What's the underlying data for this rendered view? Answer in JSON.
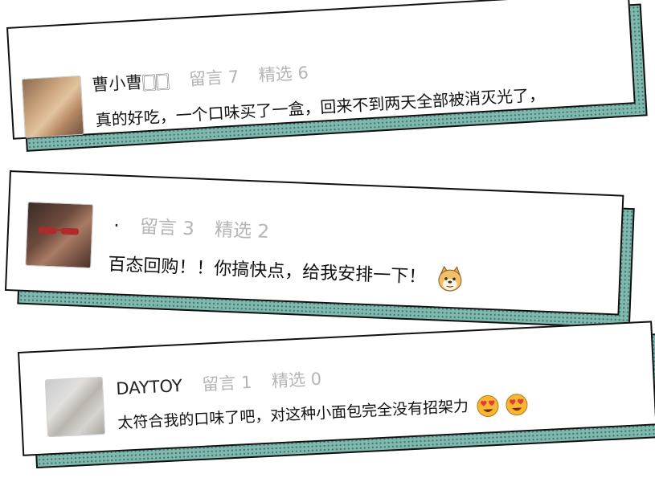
{
  "labels": {
    "comments": "留言",
    "featured": "精选"
  },
  "comments": [
    {
      "username": "曹小曹🀆🀆",
      "comment_count": 7,
      "featured_count": 6,
      "text": "真的好吃，一个口味买了一盒，回来不到两天全部被消灭光了，",
      "avatar_icon": "avatar-photo-two-people",
      "emojis": []
    },
    {
      "username": "·",
      "comment_count": 3,
      "featured_count": 2,
      "text": "百态回购！！你搞快点，给我安排一下！",
      "avatar_icon": "avatar-photo-girl-sunglasses",
      "emojis": [
        "doge-emoji"
      ]
    },
    {
      "username": "DAYTOY",
      "comment_count": 1,
      "featured_count": 0,
      "text": "太符合我的口味了吧，对这种小面包完全没有招架力",
      "avatar_icon": "avatar-photo-blurry",
      "emojis": [
        "heart-eyes-emoji",
        "heart-eyes-emoji"
      ]
    }
  ],
  "colors": {
    "shadow_teal": "#7fb8ad",
    "stat_gray": "#b5b5b5",
    "border": "#111111"
  }
}
